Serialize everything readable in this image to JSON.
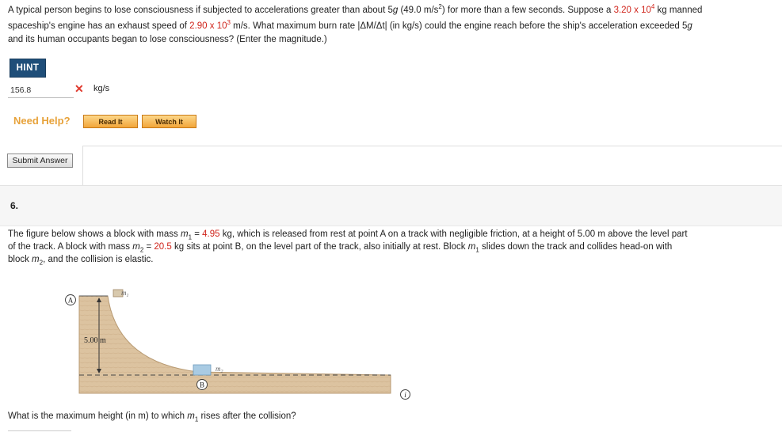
{
  "prev_question": {
    "line1_a": "A typical person begins to lose consciousness if subjected to accelerations greater than about 5",
    "line1_g": "g",
    "line1_b": " (49.0 m/s",
    "line1_exp": "2",
    "line1_c": ") for more than a few seconds. Suppose a ",
    "mass_val": "3.20 x 10",
    "mass_exp": "4",
    "line1_d": " kg manned",
    "line2_a": "spaceship's engine has an exhaust speed of ",
    "speed_val": "2.90 x 10",
    "speed_exp": "3",
    "line2_b": " m/s. What maximum burn rate |ΔM/Δt| (in kg/s) could the engine reach before the ship's acceleration exceeded 5",
    "line2_g": "g",
    "line3": "and its human occupants began to lose consciousness? (Enter the magnitude.)",
    "hint_label": "HINT",
    "answer_value": "156.8",
    "answer_unit": "kg/s",
    "need_help": "Need Help?",
    "read_it": "Read It",
    "watch_it": "Watch It",
    "submit": "Submit Answer"
  },
  "question6": {
    "number": "6.",
    "p1_a": "The figure below shows a block with mass ",
    "m1_sym": "m",
    "sub1": "1",
    "p1_b": " = ",
    "m1_val": "4.95",
    "p1_c": " kg, which is released from rest at point A on a track with negligible friction, at a height of 5.00 m above the level part",
    "p2_a": "of the track. A block with mass ",
    "m2_sym": "m",
    "sub2": "2",
    "p2_b": " = ",
    "m2_val": "20.5",
    "p2_c": " kg sits at point B, on the level part of the track, also initially at rest. Block ",
    "m1b_sym": "m",
    "sub1b": "1",
    "p2_d": " slides down the track and collides head-on with",
    "p3_a": "block ",
    "m2b_sym": "m",
    "sub2b": "2",
    "p3_b": ", and the collision is elastic.",
    "question_a": "What is the maximum height (in m) to which ",
    "q_sym": "m",
    "q_sub": "1",
    "question_b": " rises after the collision?",
    "figure": {
      "label_a": "A",
      "label_b": "B",
      "label_m1": "m",
      "label_m1_sub": "1",
      "label_m2": "m",
      "label_m2_sub": "2",
      "height_label": "5.00 m"
    },
    "info_icon": "i"
  },
  "colors": {
    "given_value": "#d0241b",
    "hint_bg": "#1f4e79",
    "need_help": "#e7a23a",
    "track": "#d9bf9a"
  }
}
